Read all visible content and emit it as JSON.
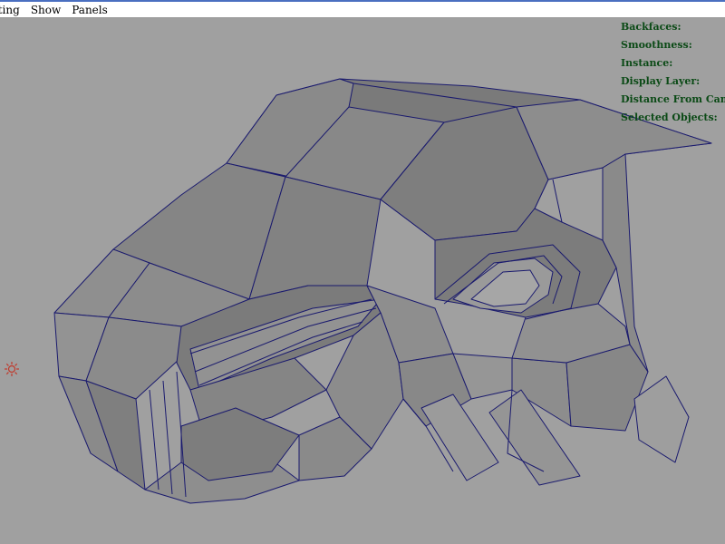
{
  "menu": {
    "lighting": "hting",
    "show": "Show",
    "panels": "Panels"
  },
  "hud": {
    "backfaces": "Backfaces:",
    "smoothness": "Smoothness:",
    "instance": "Instance:",
    "display_layer": "Display Layer:",
    "distance": "Distance From Camera:",
    "selected": "Selected Objects:"
  },
  "colors": {
    "wire": "#1a1a6e",
    "accent": "#4a6fc0",
    "hud_text": "#0b4a16",
    "light_icon": "#c0392b"
  },
  "icons": {
    "light": "directional-light-icon"
  }
}
